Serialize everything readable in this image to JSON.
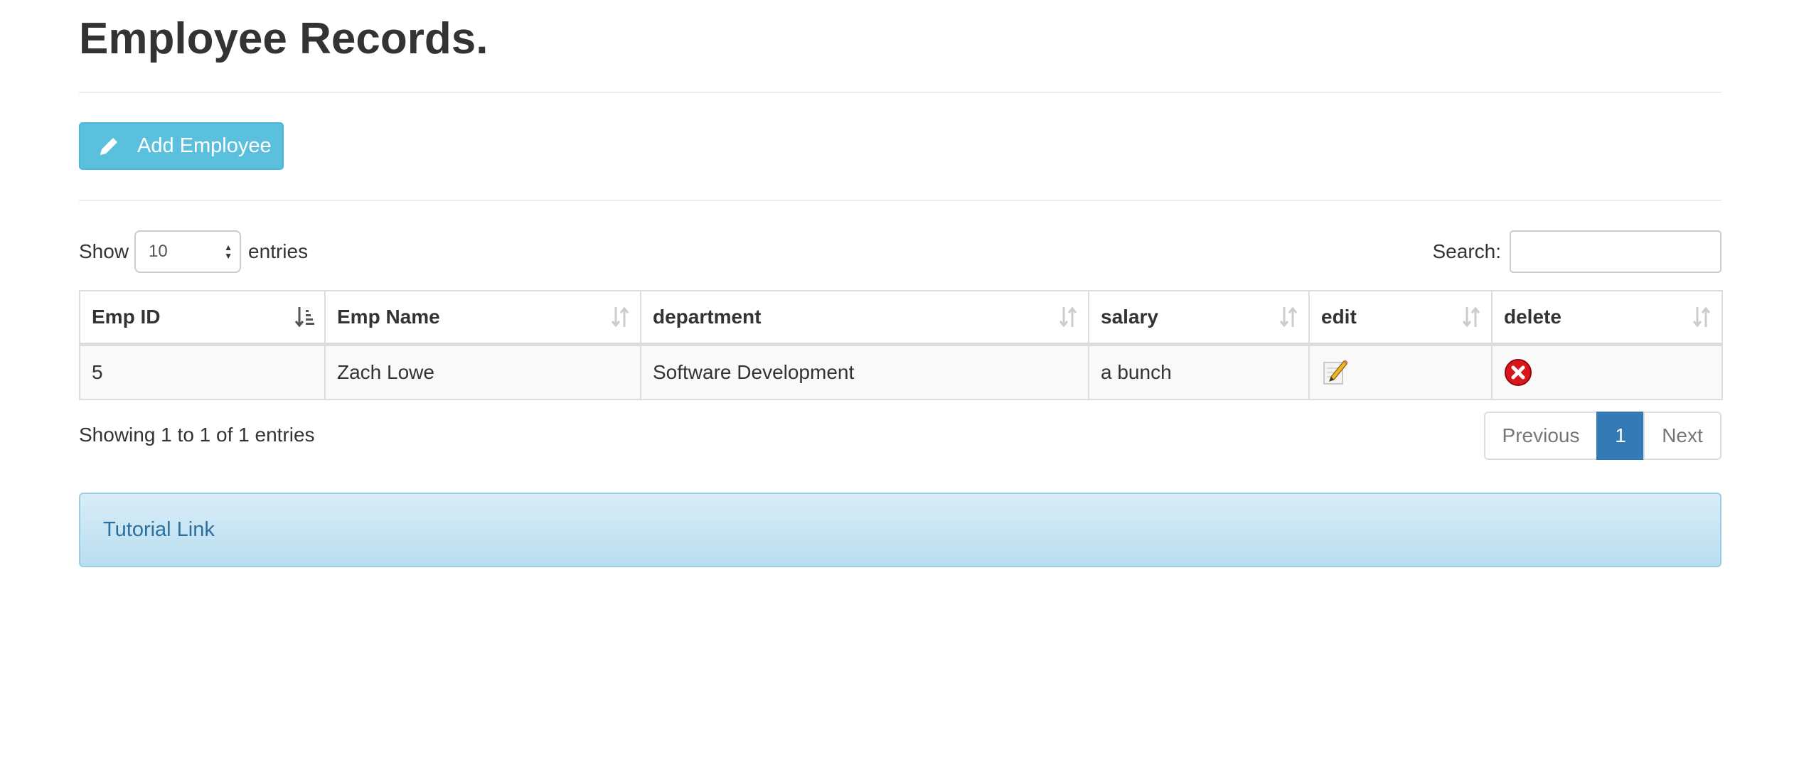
{
  "header": {
    "title": "Employee Records."
  },
  "toolbar": {
    "add_label": "Add Employee"
  },
  "length_control": {
    "prefix": "Show",
    "selected": "10",
    "suffix": "entries"
  },
  "search": {
    "label": "Search:",
    "value": "",
    "placeholder": ""
  },
  "table": {
    "columns": [
      {
        "label": "Emp ID",
        "sort": "asc"
      },
      {
        "label": "Emp Name",
        "sort": "none"
      },
      {
        "label": "department",
        "sort": "none"
      },
      {
        "label": "salary",
        "sort": "none"
      },
      {
        "label": "edit",
        "sort": "none"
      },
      {
        "label": "delete",
        "sort": "none"
      }
    ],
    "rows": [
      {
        "emp_id": "5",
        "emp_name": "Zach Lowe",
        "department": "Software Development",
        "salary": "a bunch",
        "edit_icon": "edit-pencil-icon",
        "delete_icon": "delete-x-icon"
      }
    ]
  },
  "footer": {
    "info": "Showing 1 to 1 of 1 entries",
    "pagination": {
      "previous": "Previous",
      "current": "1",
      "next": "Next"
    }
  },
  "alert": {
    "link_text": "Tutorial Link"
  },
  "colors": {
    "button_info": "#5bc0de",
    "page_active": "#337ab7",
    "alert_bg": "#d9edf7",
    "link": "#2f6f9f",
    "delete_red": "#d9161c"
  }
}
